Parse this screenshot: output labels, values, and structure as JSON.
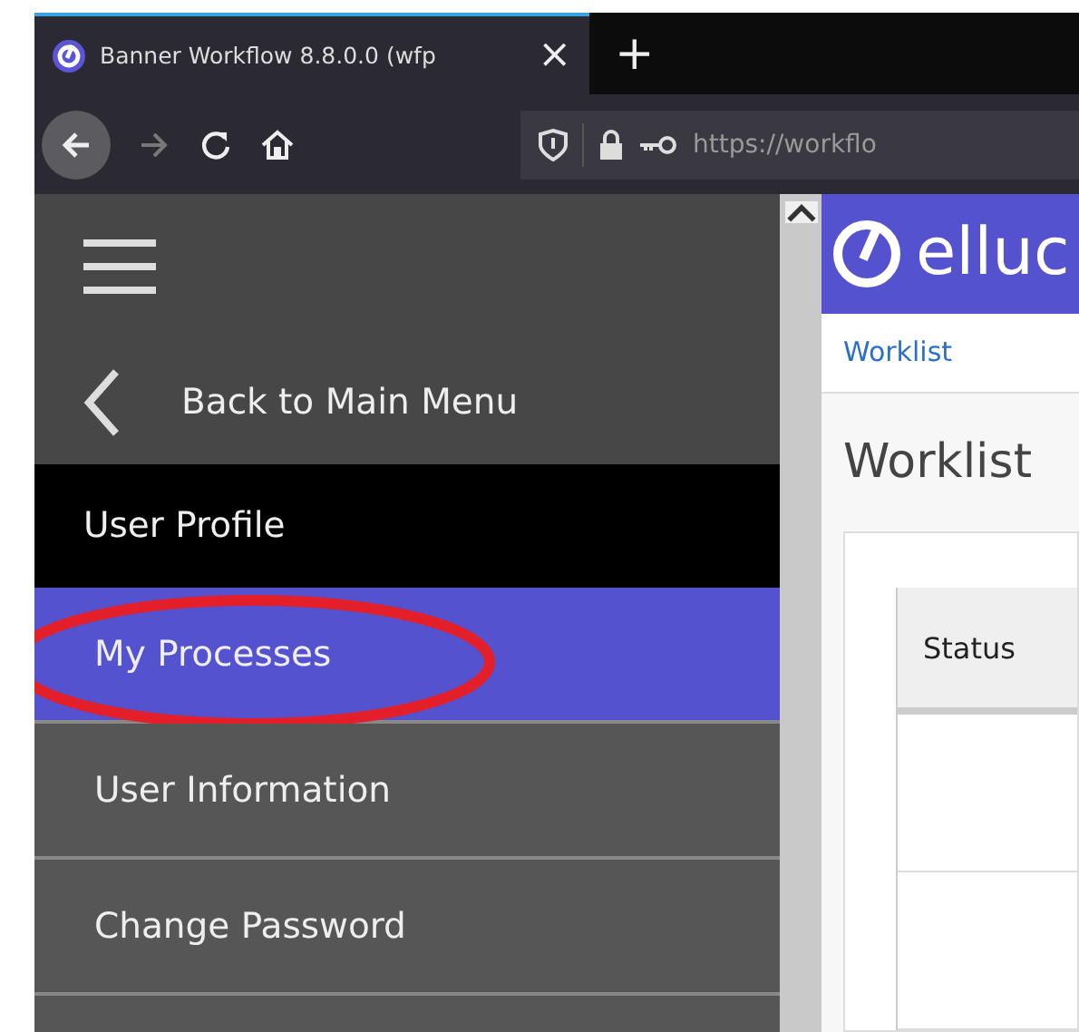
{
  "browser": {
    "tab": {
      "title": "Banner Workflow 8.8.0.0 (wfp",
      "close": "×"
    },
    "new_tab": "+",
    "url": "https://workflo"
  },
  "sidebar": {
    "back": "Back to Main Menu",
    "section": "User Profile",
    "items": [
      {
        "label": "My Processes",
        "selected": true,
        "highlighted": true
      },
      {
        "label": "User Information",
        "selected": false,
        "highlighted": false
      },
      {
        "label": "Change Password",
        "selected": false,
        "highlighted": false
      }
    ]
  },
  "header": {
    "logo_text": "elluc"
  },
  "breadcrumb": "Worklist",
  "page_title": "Worklist",
  "table": {
    "columns": [
      "Status"
    ]
  }
}
